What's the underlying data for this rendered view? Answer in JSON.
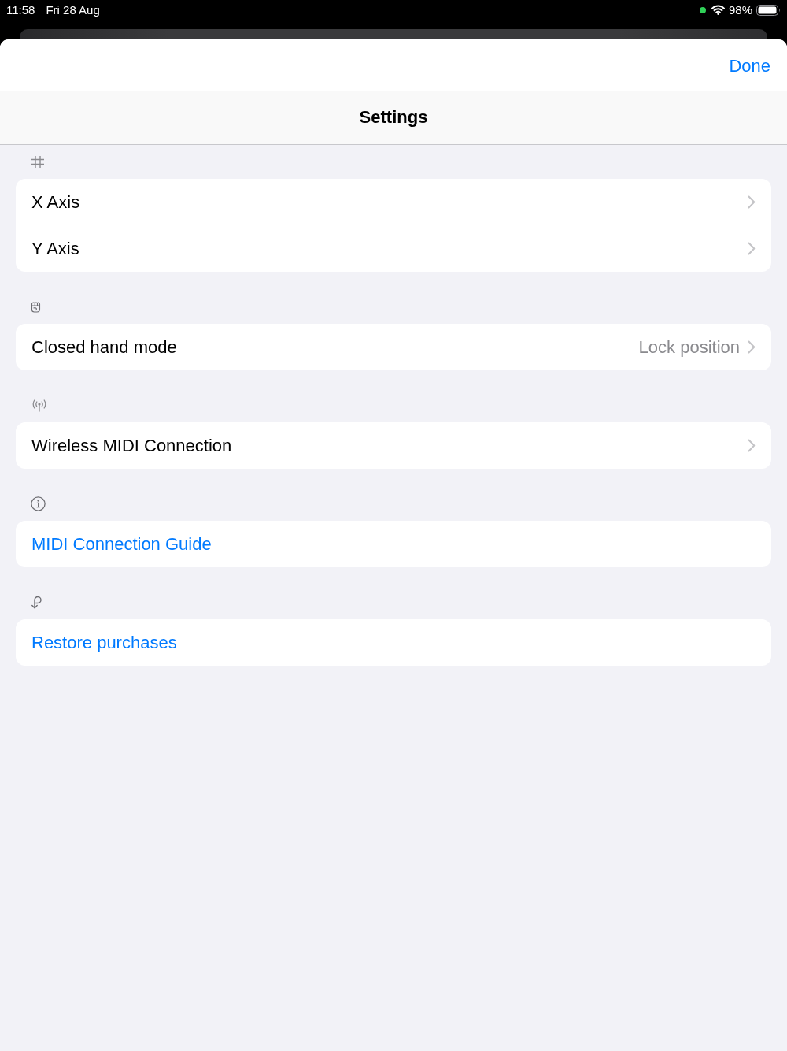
{
  "status_bar": {
    "time": "11:58",
    "date": "Fri 28 Aug",
    "battery": "98%"
  },
  "sheet": {
    "done_button": "Done",
    "title": "Settings"
  },
  "sections": [
    {
      "rows": [
        {
          "label": "X Axis",
          "kind": "disclosure"
        },
        {
          "label": "Y Axis",
          "kind": "disclosure"
        }
      ]
    },
    {
      "rows": [
        {
          "label": "Closed hand mode",
          "kind": "disclosure",
          "value": "Lock position"
        }
      ]
    },
    {
      "rows": [
        {
          "label": "Wireless MIDI Connection",
          "kind": "disclosure"
        }
      ]
    },
    {
      "rows": [
        {
          "label": "MIDI Connection Guide",
          "kind": "action"
        }
      ]
    },
    {
      "rows": [
        {
          "label": "Restore purchases",
          "kind": "action"
        }
      ]
    }
  ]
}
